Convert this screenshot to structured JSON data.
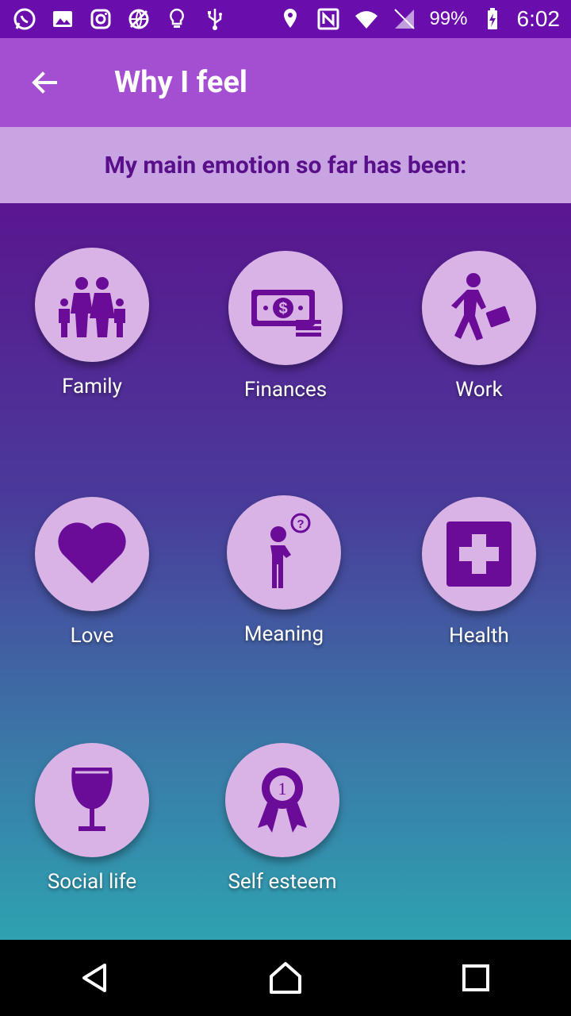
{
  "status_bar": {
    "left_icons": [
      "whatsapp-icon",
      "image-icon",
      "instagram-icon",
      "globe-icon",
      "lightbulb-icon",
      "usb-icon"
    ],
    "right_icons": [
      "location-icon",
      "nfc-icon",
      "wifi-icon",
      "no-sim-icon"
    ],
    "battery": "99%",
    "time": "6:02"
  },
  "app_bar": {
    "title": "Why I feel"
  },
  "subheader": {
    "text": "My main emotion so far has been:"
  },
  "categories": [
    {
      "label": "Family",
      "icon": "family-icon"
    },
    {
      "label": "Finances",
      "icon": "money-icon"
    },
    {
      "label": "Work",
      "icon": "worker-icon"
    },
    {
      "label": "Love",
      "icon": "heart-icon"
    },
    {
      "label": "Meaning",
      "icon": "thinking-person-icon"
    },
    {
      "label": "Health",
      "icon": "medical-cross-icon"
    },
    {
      "label": "Social life",
      "icon": "wine-glass-icon"
    },
    {
      "label": "Self esteem",
      "icon": "award-ribbon-icon"
    }
  ],
  "colors": {
    "status_bar": "#6a0dad",
    "app_bar": "#a44fd2",
    "subheader_bg": "#c8a4e2",
    "accent_dark": "#5a0f8a",
    "icon_circle": "#d9b3e6",
    "icon_fill": "#6b0c98"
  },
  "nav_bar": [
    "back-icon",
    "home-icon",
    "recents-icon"
  ]
}
